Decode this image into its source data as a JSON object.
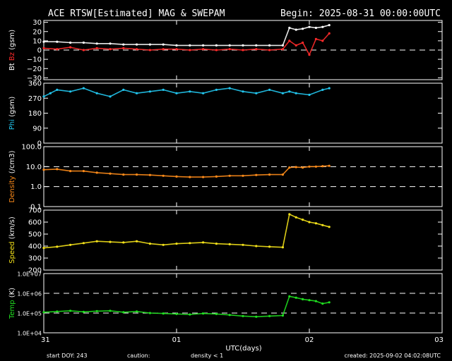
{
  "header": {
    "title": "ACE RTSW[Estimated] MAG & SWEPAM",
    "begin": "Begin: 2025-08-31 00:00:00UTC"
  },
  "footer": {
    "start_doy": "start DOY: 243",
    "caution": "caution:",
    "caution_note": "density < 1",
    "created": "created: 2025-09-02 04:02:08UTC"
  },
  "colors": {
    "background": "#000000",
    "axes": "#ffffff",
    "bt": "#ffffff",
    "bz": "#ff2a2a",
    "phi": "#22c6ee",
    "density": "#ff8c1a",
    "speed": "#f4e21a",
    "temp": "#1fe01f",
    "caution": "#ff8c1a"
  },
  "chart_data": [
    {
      "type": "scatter",
      "panel": "mag",
      "ylabel_parts": [
        "Bt",
        "Bz",
        "(gsm)"
      ],
      "ylim": [
        -32,
        32
      ],
      "yticks": [
        30,
        20,
        10,
        0,
        -10,
        -20,
        -30
      ],
      "ytick_labels": [
        "30",
        "20",
        "10",
        "0",
        "−10",
        "−20",
        "−30"
      ],
      "dashed_lines": [
        0
      ],
      "series": [
        {
          "name": "Bt",
          "color_key": "bt",
          "x": [
            0,
            0.1,
            0.2,
            0.3,
            0.4,
            0.5,
            0.6,
            0.7,
            0.8,
            0.9,
            1.0,
            1.1,
            1.2,
            1.3,
            1.4,
            1.5,
            1.6,
            1.7,
            1.8,
            1.85,
            1.9,
            1.95,
            2.0,
            2.05,
            2.1,
            2.15
          ],
          "y": [
            9,
            9,
            8,
            8,
            7,
            7,
            6,
            6,
            6,
            6,
            5,
            5,
            5,
            5,
            5,
            5,
            5,
            5,
            5,
            24,
            22,
            23,
            25,
            24,
            25,
            27
          ]
        },
        {
          "name": "Bz",
          "color_key": "bz",
          "x": [
            0,
            0.1,
            0.2,
            0.3,
            0.4,
            0.5,
            0.6,
            0.7,
            0.8,
            0.9,
            1.0,
            1.1,
            1.2,
            1.3,
            1.4,
            1.5,
            1.6,
            1.7,
            1.8,
            1.85,
            1.9,
            1.95,
            2.0,
            2.05,
            2.1,
            2.15
          ],
          "y": [
            2,
            1,
            3,
            0,
            2,
            1,
            2,
            1,
            0,
            1,
            1,
            0,
            1,
            0,
            1,
            0,
            1,
            0,
            1,
            10,
            5,
            8,
            -5,
            12,
            10,
            18
          ]
        }
      ]
    },
    {
      "type": "scatter",
      "panel": "phi",
      "ylabel_parts": [
        "Phi",
        "(gsm)"
      ],
      "ylim": [
        0,
        360
      ],
      "yticks": [
        360,
        270,
        180,
        90,
        0
      ],
      "ytick_labels": [
        "360",
        "270",
        "180",
        "90",
        "0"
      ],
      "dashed_lines": [],
      "series": [
        {
          "name": "Phi",
          "color_key": "phi",
          "x": [
            0,
            0.05,
            0.1,
            0.2,
            0.3,
            0.4,
            0.5,
            0.6,
            0.7,
            0.8,
            0.9,
            1.0,
            1.1,
            1.2,
            1.3,
            1.4,
            1.5,
            1.6,
            1.7,
            1.8,
            1.85,
            1.9,
            2.0,
            2.1,
            2.15
          ],
          "y": [
            280,
            300,
            320,
            310,
            330,
            300,
            280,
            320,
            300,
            310,
            320,
            300,
            310,
            300,
            320,
            330,
            310,
            300,
            320,
            300,
            310,
            300,
            290,
            320,
            330
          ]
        }
      ]
    },
    {
      "type": "scatter",
      "panel": "density",
      "ylabel_parts": [
        "Density",
        "(/cm3)"
      ],
      "scale": "log",
      "ylim": [
        0.1,
        100.0
      ],
      "yticks": [
        100.0,
        10.0,
        1.0,
        0.1
      ],
      "ytick_labels": [
        "100.0",
        "10.0",
        "1.0",
        "0.1"
      ],
      "dashed_lines": [
        10.0,
        1.0
      ],
      "series": [
        {
          "name": "Density",
          "color_key": "density",
          "x": [
            0,
            0.1,
            0.2,
            0.3,
            0.4,
            0.5,
            0.6,
            0.7,
            0.8,
            0.9,
            1.0,
            1.1,
            1.2,
            1.3,
            1.4,
            1.5,
            1.6,
            1.7,
            1.8,
            1.85,
            1.9,
            1.95,
            2.0,
            2.05,
            2.1,
            2.15
          ],
          "y": [
            7,
            7.5,
            6,
            6,
            5,
            4.5,
            4,
            4,
            3.8,
            3.5,
            3.2,
            3,
            3,
            3.2,
            3.5,
            3.5,
            3.8,
            4,
            4,
            9,
            9.5,
            9,
            10,
            10,
            10.5,
            11
          ]
        }
      ]
    },
    {
      "type": "scatter",
      "panel": "speed",
      "ylabel_parts": [
        "Speed",
        "(km/s)"
      ],
      "ylim": [
        200,
        700
      ],
      "yticks": [
        700,
        600,
        500,
        400,
        300,
        200
      ],
      "ytick_labels": [
        "700",
        "600",
        "500",
        "400",
        "300",
        "200"
      ],
      "dashed_lines": [],
      "series": [
        {
          "name": "Speed",
          "color_key": "speed",
          "x": [
            0,
            0.1,
            0.2,
            0.3,
            0.4,
            0.5,
            0.6,
            0.7,
            0.8,
            0.9,
            1.0,
            1.1,
            1.2,
            1.3,
            1.4,
            1.5,
            1.6,
            1.7,
            1.8,
            1.85,
            1.9,
            1.95,
            2.0,
            2.05,
            2.1,
            2.15
          ],
          "y": [
            385,
            395,
            410,
            425,
            440,
            435,
            430,
            440,
            420,
            410,
            420,
            425,
            430,
            420,
            415,
            410,
            400,
            395,
            390,
            665,
            640,
            620,
            600,
            590,
            575,
            560
          ]
        }
      ]
    },
    {
      "type": "scatter",
      "panel": "temp",
      "ylabel_parts": [
        "Temp",
        "(K)"
      ],
      "scale": "log",
      "ylim": [
        10000,
        10000000
      ],
      "yticks": [
        10000000,
        1000000,
        100000,
        10000
      ],
      "ytick_labels": [
        "1.0E+07",
        "1.0E+06",
        "1.0E+05",
        "1.0E+04"
      ],
      "dashed_lines": [
        1000000,
        100000
      ],
      "series": [
        {
          "name": "Temp",
          "color_key": "temp",
          "x": [
            0,
            0.1,
            0.2,
            0.3,
            0.4,
            0.5,
            0.6,
            0.7,
            0.8,
            0.9,
            1.0,
            1.1,
            1.2,
            1.3,
            1.4,
            1.5,
            1.6,
            1.7,
            1.8,
            1.85,
            1.9,
            1.95,
            2.0,
            2.05,
            2.1,
            2.15
          ],
          "y": [
            110000,
            120000,
            130000,
            115000,
            125000,
            130000,
            110000,
            120000,
            100000,
            95000,
            90000,
            85000,
            95000,
            90000,
            80000,
            70000,
            65000,
            70000,
            75000,
            700000,
            600000,
            500000,
            450000,
            400000,
            300000,
            350000
          ]
        }
      ]
    }
  ],
  "x_axis": {
    "label": "UTC(days)",
    "xlim": [
      0,
      3
    ],
    "ticks": [
      0,
      1,
      2,
      3
    ],
    "tick_labels": [
      "31",
      "01",
      "02",
      "03"
    ]
  }
}
